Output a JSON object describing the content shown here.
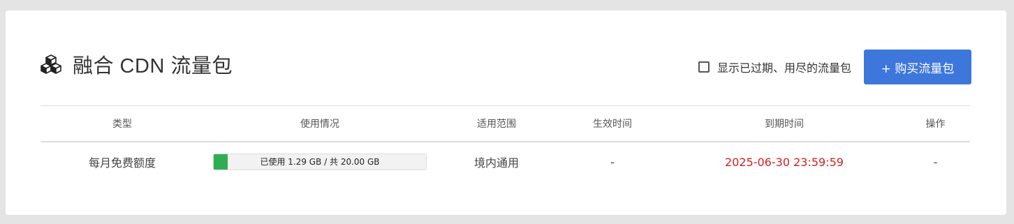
{
  "header": {
    "title": "融合 CDN 流量包",
    "title_icon": "cubes-icon"
  },
  "toolbar": {
    "show_expired_label": "显示已过期、用尽的流量包",
    "show_expired_checked": false,
    "buy_button_label": "+ 购买流量包",
    "buy_button_color": "#3e77dc"
  },
  "table": {
    "columns": [
      "类型",
      "使用情况",
      "适用范围",
      "生效时间",
      "到期时间",
      "操作"
    ],
    "rows": [
      {
        "type": "每月免费额度",
        "usage_text": "已使用 1.29 GB / 共 20.00 GB",
        "used_gb": 1.29,
        "total_gb": 20.0,
        "scope": "境内通用",
        "effective_time": "-",
        "expire_time": "2025-06-30 23:59:59",
        "expire_color": "#d42020",
        "action": "-"
      }
    ]
  }
}
